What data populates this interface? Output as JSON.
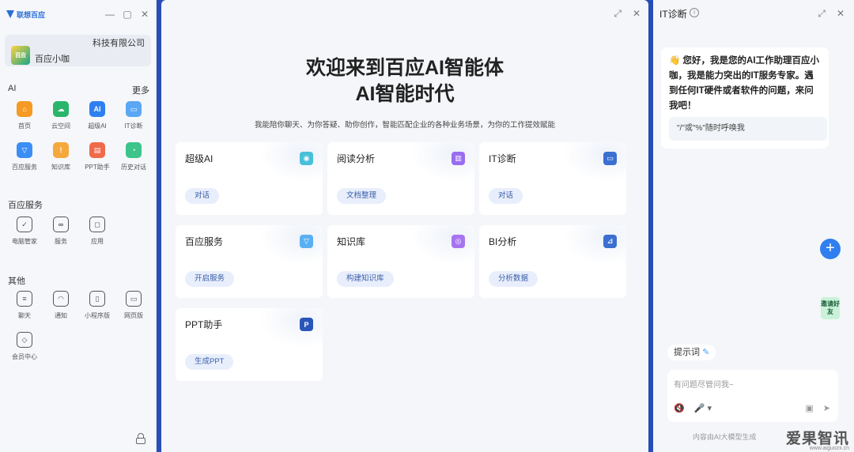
{
  "left": {
    "brand": "联想百应",
    "window_controls": [
      "—",
      "▢",
      "✕"
    ],
    "company": "科技有限公司",
    "avatar_text": "百应",
    "user_name": "百应小咖",
    "sections": [
      {
        "title": "AI",
        "more": "更多",
        "items": [
          {
            "label": "首页",
            "icon": "home-icon",
            "color": "#f59a23",
            "glyph": "⌂"
          },
          {
            "label": "云空间",
            "icon": "cloud-space-icon",
            "color": "#2bb56b",
            "glyph": "☁"
          },
          {
            "label": "超级AI",
            "icon": "super-ai-icon",
            "color": "#2f7ff0",
            "glyph": "AI"
          },
          {
            "label": "IT诊断",
            "icon": "it-diagnosis-icon",
            "color": "#5aa7f5",
            "glyph": "▭"
          },
          {
            "label": "百应服务",
            "icon": "service-icon",
            "color": "#3a8ef6",
            "glyph": "▽"
          },
          {
            "label": "知识库",
            "icon": "knowledge-icon",
            "color": "#f6a93b",
            "glyph": "!"
          },
          {
            "label": "PPT助手",
            "icon": "ppt-icon",
            "color": "#f06a4a",
            "glyph": "▤"
          },
          {
            "label": "历史对话",
            "icon": "history-icon",
            "color": "#3cc48a",
            "glyph": "◔"
          }
        ]
      },
      {
        "title": "百应服务",
        "items": [
          {
            "label": "电脑管家",
            "icon": "shield-icon",
            "glyph": "✓"
          },
          {
            "label": "服务",
            "icon": "service-link-icon",
            "glyph": "∞"
          },
          {
            "label": "应用",
            "icon": "bag-icon",
            "glyph": "◻"
          }
        ]
      },
      {
        "title": "其他",
        "items": [
          {
            "label": "聊天",
            "icon": "chat-icon",
            "glyph": "≡"
          },
          {
            "label": "通知",
            "icon": "bell-icon",
            "glyph": "◠"
          },
          {
            "label": "小程序版",
            "icon": "mobile-icon",
            "glyph": "▯"
          },
          {
            "label": "网页版",
            "icon": "monitor-icon",
            "glyph": "▭"
          },
          {
            "label": "会员中心",
            "icon": "diamond-icon",
            "glyph": "◇"
          }
        ]
      }
    ]
  },
  "center": {
    "window_controls": [
      "⤢",
      "✕"
    ],
    "title_line1": "欢迎来到百应AI智能体",
    "title_line2": "AI智能时代",
    "subtitle": "我能陪你聊天、为你答疑、助你创作，智能匹配企业的各种业务场景，为你的工作提效赋能",
    "cards": [
      {
        "title": "超级AI",
        "tag": "对话",
        "icon": "super-ai-card-icon",
        "color": "#47c0d8",
        "glyph": "◉"
      },
      {
        "title": "阅读分析",
        "tag": "文档整理",
        "icon": "book-icon",
        "color": "#9a6cf0",
        "glyph": "▥"
      },
      {
        "title": "IT诊断",
        "tag": "对话",
        "icon": "it-card-icon",
        "color": "#3b6fd0",
        "glyph": "▭"
      },
      {
        "title": "百应服务",
        "tag": "开启服务",
        "icon": "service-card-icon",
        "color": "#5ab0f3",
        "glyph": "▽"
      },
      {
        "title": "知识库",
        "tag": "构建知识库",
        "icon": "knowledge-card-icon",
        "color": "#a774f0",
        "glyph": "◎"
      },
      {
        "title": "BI分析",
        "tag": "分析数据",
        "icon": "chart-card-icon",
        "color": "#3b6fd0",
        "glyph": "⊿"
      },
      {
        "title": "PPT助手",
        "tag": "生成PPT",
        "icon": "ppt-card-icon",
        "color": "#2a56b8",
        "glyph": "P"
      }
    ]
  },
  "right": {
    "title": "IT诊断",
    "info": "i",
    "window_controls": [
      "⤢",
      "✕"
    ],
    "greeting_emoji": "👋",
    "greeting": "您好，我是您的AI工作助理百应小咖，我是能力突出的IT服务专家。遇到任何IT硬件或者软件的问题，来问我吧！",
    "hint": "\"/\"或\"%\"随时呼唤我",
    "plus": "+",
    "invite": "邀请好友",
    "prompt_label": "提示词",
    "input_placeholder": "有问题尽管问我~",
    "tool_mute": "🔇",
    "tool_mic": "🎤 ▾",
    "tool_image": "▣",
    "tool_send": "➤",
    "footer": "内容由AI大模型生成",
    "watermark": "爱果智讯",
    "watermark_url": "www.aiguozx.cn"
  }
}
